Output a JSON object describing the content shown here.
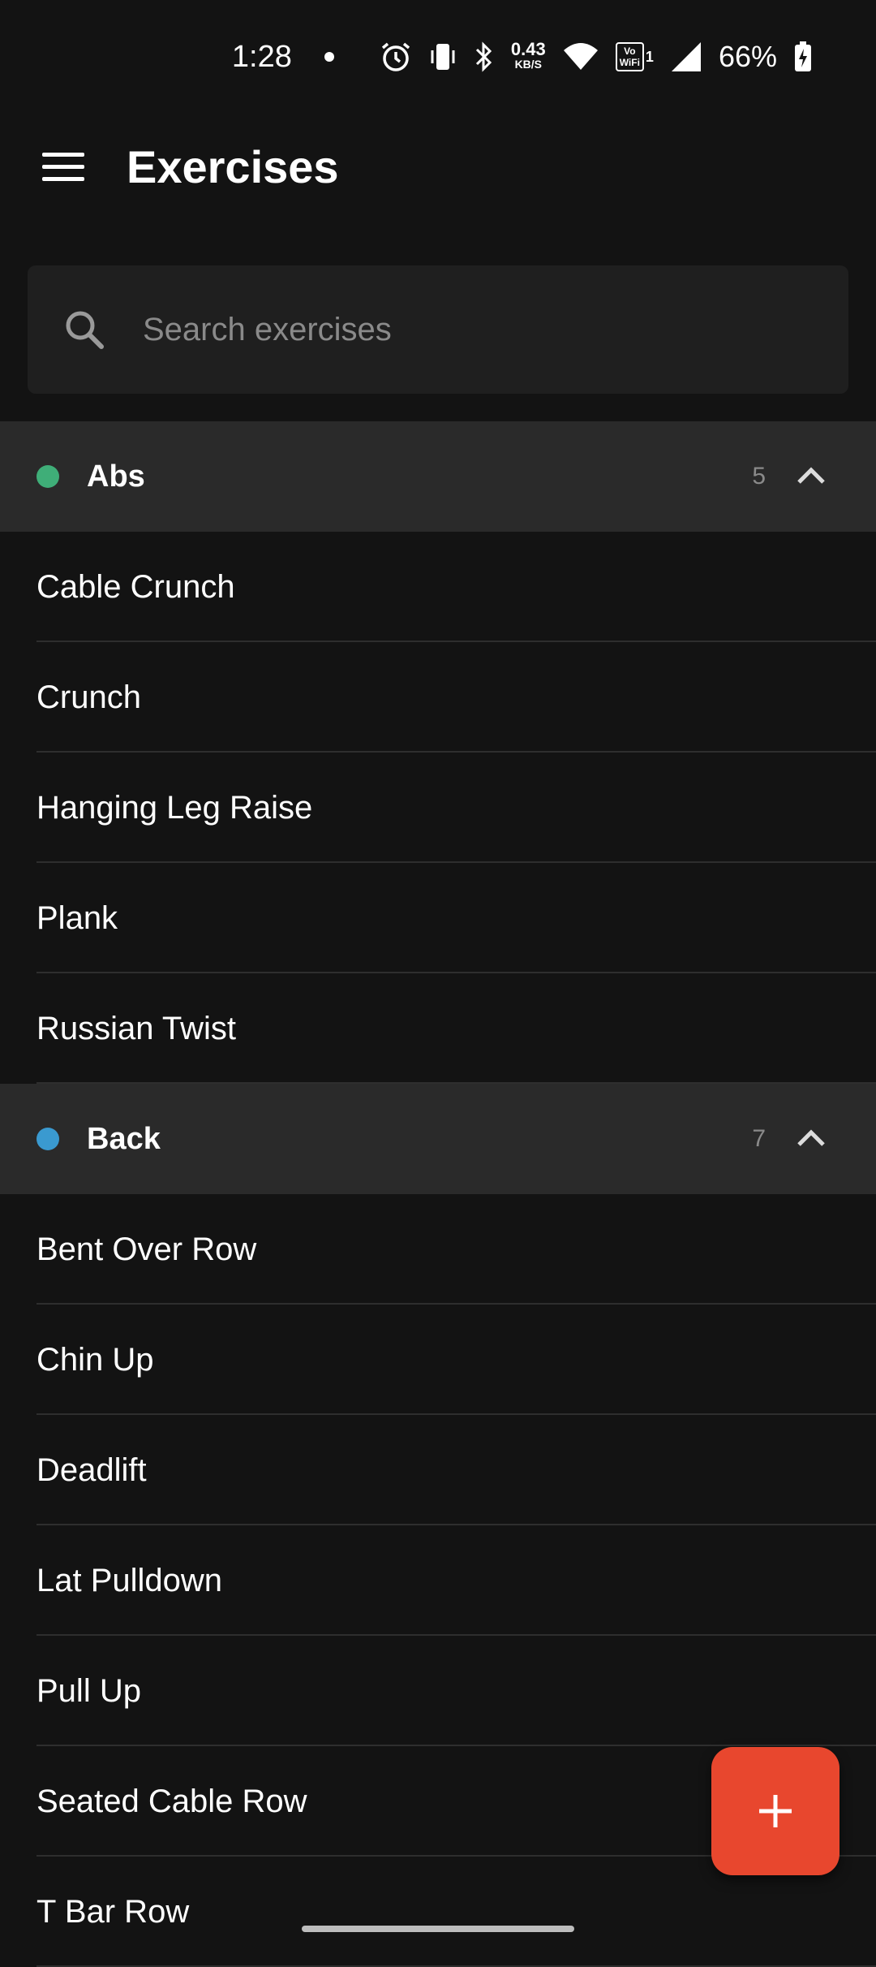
{
  "status_bar": {
    "time": "1:28",
    "net_speed_value": "0.43",
    "net_speed_unit": "KB/S",
    "wifi_calling_label_top": "Vo",
    "wifi_calling_label_bottom": "WiFi",
    "wifi_calling_number": "1",
    "battery_percent": "66%"
  },
  "app_bar": {
    "title": "Exercises",
    "menu_icon": "hamburger-menu-icon"
  },
  "search": {
    "placeholder": "Search exercises",
    "value": "",
    "icon": "search-icon"
  },
  "sections": [
    {
      "title": "Abs",
      "count": "5",
      "color": "#3fae78",
      "items": [
        "Cable Crunch",
        "Crunch",
        "Hanging Leg Raise",
        "Plank",
        "Russian Twist"
      ]
    },
    {
      "title": "Back",
      "count": "7",
      "color": "#3a9ad0",
      "items": [
        "Bent Over Row",
        "Chin Up",
        "Deadlift",
        "Lat Pulldown",
        "Pull Up",
        "Seated Cable Row",
        "T Bar Row"
      ]
    }
  ],
  "fab": {
    "icon": "plus-icon",
    "color": "#e8472e"
  }
}
